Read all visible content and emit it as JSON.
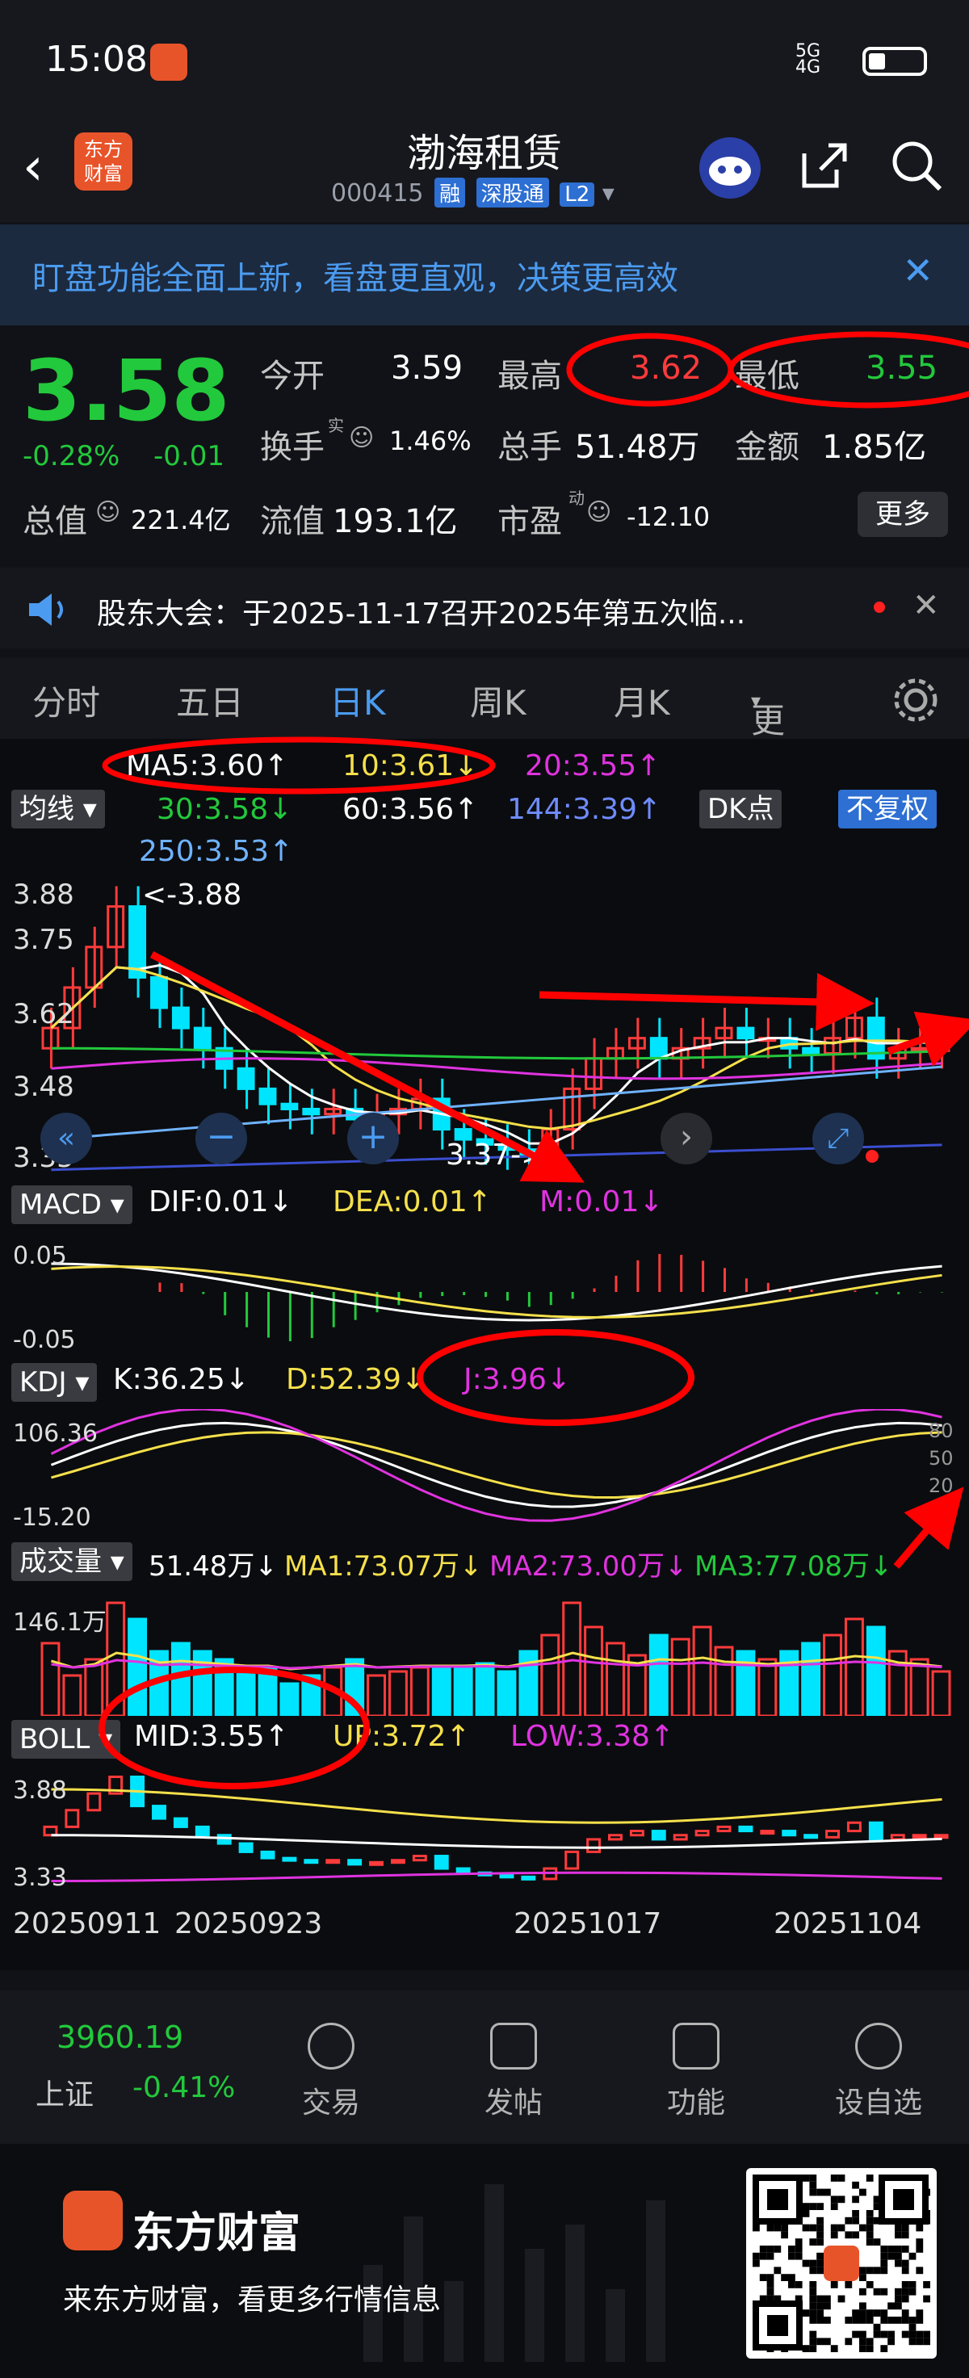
{
  "status_bar": {
    "time": "15:08",
    "network": "5G",
    "signal": "4G"
  },
  "header": {
    "stock_name": "渤海租赁",
    "stock_code": "000415",
    "tags": [
      "融",
      "深股通",
      "L2"
    ],
    "brand_logo": [
      "东方",
      "财富"
    ]
  },
  "banner": {
    "text": "盯盘功能全面上新，看盘更直观，决策更高效"
  },
  "quote": {
    "price": "3.58",
    "change_pct": "-0.28%",
    "change": "-0.01",
    "open_label": "今开",
    "open": "3.59",
    "high_label": "最高",
    "high": "3.62",
    "low_label": "最低",
    "low": "3.55",
    "turnover_label": "换手",
    "turnover": "1.46%",
    "volume_label": "总手",
    "volume": "51.48万",
    "amount_label": "金额",
    "amount": "1.85亿",
    "mcap_label": "总值",
    "mcap": "221.4亿",
    "float_label": "流值",
    "float": "193.1亿",
    "pe_label": "市盈",
    "pe": "-12.10",
    "more_label": "更多",
    "sup_shi": "实",
    "sup_dong": "动"
  },
  "notice": {
    "text": "股东大会：于2025-11-17召开2025年第五次临..."
  },
  "tabs": [
    "分时",
    "五日",
    "日K",
    "周K",
    "月K",
    "更多"
  ],
  "ma": {
    "label": "均线",
    "ma5": "MA5:3.60↑",
    "ma10": "10:3.61↓",
    "ma20": "20:3.55↑",
    "ma30": "30:3.58↓",
    "ma60": "60:3.56↑",
    "ma144": "144:3.39↑",
    "ma250": "250:3.53↑",
    "dk": "DK点",
    "fq": "不复权"
  },
  "kline": {
    "y_top": "3.88",
    "y2": "3.75",
    "y3": "3.62",
    "y4": "3.48",
    "y5": "3.35",
    "high_mark": "<-3.88",
    "low_mark": "3.37->"
  },
  "macd": {
    "label": "MACD",
    "dif": "DIF:0.01↓",
    "dea": "DEA:0.01↑",
    "m": "M:0.01↓",
    "y1": "0.05",
    "y2": "-0.05"
  },
  "kdj": {
    "label": "KDJ",
    "k": "K:36.25↓",
    "d": "D:52.39↓",
    "j": "J:3.96↓",
    "y1": "106.36",
    "y2": "-15.20",
    "r80": "80",
    "r50": "50",
    "r20": "20"
  },
  "vol": {
    "label": "成交量",
    "v": "51.48万↓",
    "ma1": "MA1:73.07万↓",
    "ma2": "MA2:73.00万↓",
    "ma3": "MA3:77.08万↓",
    "y1": "146.1万"
  },
  "boll": {
    "label": "BOLL",
    "mid": "MID:3.55↑",
    "up": "UP:3.72↑",
    "low": "LOW:3.38↑",
    "y1": "3.88",
    "y2": "3.33"
  },
  "dates": [
    "20250911",
    "20250923",
    "20251017",
    "20251104"
  ],
  "bottom_nav": {
    "index_value": "3960.19",
    "index_name": "上证",
    "index_change": "-0.41%",
    "items": [
      "交易",
      "发帖",
      "功能",
      "设自选"
    ]
  },
  "footer": {
    "brand": "东方财富",
    "slogan": "来东方财富，看更多行情信息"
  },
  "colors": {
    "up": "#ff3b3b",
    "down": "#22c93c",
    "cyan": "#00e5ff",
    "yellow": "#f5e04b",
    "magenta": "#e033e0",
    "blue": "#4b9bf0"
  }
}
